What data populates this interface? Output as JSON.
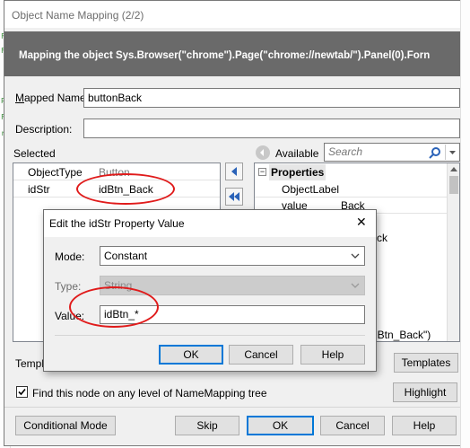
{
  "window": {
    "title": "Object Name Mapping (2/2)"
  },
  "banner": {
    "text": "Mapping the object Sys.Browser(\"chrome\").Page(\"chrome://newtab/\").Panel(0).Forn"
  },
  "mapped_name": {
    "label": "Mapped Name:",
    "value": "buttonBack"
  },
  "description": {
    "label": "Description:",
    "value": ""
  },
  "selected": {
    "label": "Selected",
    "rows": [
      {
        "name": "ObjectType",
        "value": "Button"
      },
      {
        "name": "idStr",
        "value": "idBtn_Back"
      }
    ]
  },
  "available": {
    "label": "Available",
    "search_placeholder": "Search",
    "group": "Properties",
    "rows": [
      {
        "name": "ObjectLabel",
        "value": ""
      },
      {
        "name": "value",
        "value": "Back"
      }
    ],
    "partial_right": [
      "ck",
      "dBtn_Back\")"
    ]
  },
  "background": {
    "left_marks": [
      "F",
      "F",
      "Pr",
      "F",
      "r",
      "e",
      "Pr",
      "e",
      "e",
      "e",
      "e",
      "e",
      "e"
    ]
  },
  "templates": {
    "label": "Templa",
    "button": "Templates"
  },
  "find_node": {
    "label": "Find this node on any level of NameMapping tree",
    "checked": true
  },
  "buttons": {
    "highlight": "Highlight",
    "conditional": "Conditional Mode",
    "skip": "Skip",
    "ok": "OK",
    "cancel": "Cancel",
    "help": "Help"
  },
  "edit_dialog": {
    "title": "Edit the idStr Property Value",
    "close": "✕",
    "mode_label": "Mode:",
    "mode_value": "Constant",
    "type_label": "Type:",
    "type_value": "String",
    "value_label": "Value:",
    "value": "idBtn_*",
    "ok": "OK",
    "cancel": "Cancel",
    "help": "Help"
  }
}
